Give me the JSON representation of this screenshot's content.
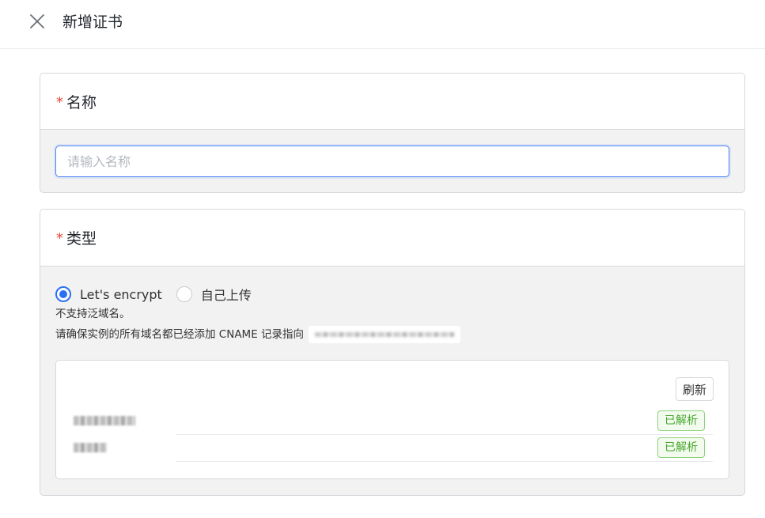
{
  "header": {
    "title": "新增证书",
    "close_icon": "close-icon"
  },
  "name_section": {
    "required_mark": "*",
    "title": "名称",
    "input_value": "",
    "input_placeholder": "请输入名称"
  },
  "type_section": {
    "required_mark": "*",
    "title": "类型",
    "options": [
      {
        "label": "Let's encrypt",
        "checked": true
      },
      {
        "label": "自己上传",
        "checked": false
      }
    ],
    "hint_line1": "不支持泛域名。",
    "hint_line2": "请确保实例的所有域名都已经添加 CNAME 记录指向",
    "refresh_label": "刷新",
    "domains": [
      {
        "status": "已解析"
      },
      {
        "status": "已解析"
      }
    ]
  },
  "colors": {
    "accent": "#2b6ff2",
    "required": "#e5483a",
    "status_ok": "#4aa82f"
  }
}
